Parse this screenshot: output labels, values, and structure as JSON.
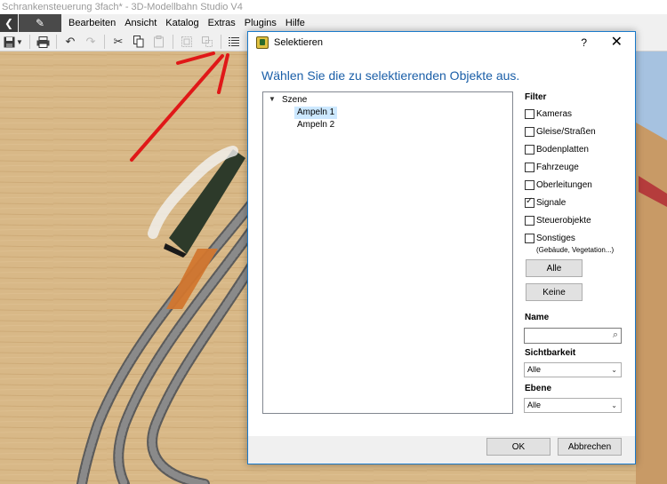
{
  "window": {
    "title": "Schrankensteuerung 3fach* - 3D-Modellbahn Studio V4"
  },
  "menubar": {
    "back_icon": "back-arrow-icon",
    "edit_icon": "pencil-icon",
    "items": [
      "Bearbeiten",
      "Ansicht",
      "Katalog",
      "Extras",
      "Plugins",
      "Hilfe"
    ]
  },
  "toolbar": {
    "buttons": [
      "save-icon",
      "save-dropdown-icon",
      "print-icon",
      "undo-icon",
      "redo-icon",
      "cut-icon",
      "copy-icon",
      "paste-icon",
      "group-icon",
      "ungroup-icon",
      "select-list-icon"
    ]
  },
  "dialog": {
    "title": "Selektieren",
    "help": "?",
    "close": "✕",
    "instruction": "Wählen Sie die zu selektierenden Objekte aus.",
    "tree": {
      "root": "Szene",
      "children": [
        {
          "label": "Ampeln 1",
          "selected": true
        },
        {
          "label": "Ampeln 2",
          "selected": false
        }
      ]
    },
    "filter": {
      "title": "Filter",
      "items": [
        {
          "label": "Kameras",
          "checked": false
        },
        {
          "label": "Gleise/Straßen",
          "checked": false
        },
        {
          "label": "Bodenplatten",
          "checked": false
        },
        {
          "label": "Fahrzeuge",
          "checked": false
        },
        {
          "label": "Oberleitungen",
          "checked": false
        },
        {
          "label": "Signale",
          "checked": true
        },
        {
          "label": "Steuerobjekte",
          "checked": false
        },
        {
          "label": "Sonstiges",
          "checked": false
        }
      ],
      "note": "(Gebäude, Vegetation...)",
      "all_label": "Alle",
      "none_label": "Keine"
    },
    "name": {
      "label": "Name",
      "value": ""
    },
    "sichtbarkeit": {
      "label": "Sichtbarkeit",
      "value": "Alle"
    },
    "ebene": {
      "label": "Ebene",
      "value": "Alle"
    },
    "ok_label": "OK",
    "cancel_label": "Abbrechen"
  }
}
